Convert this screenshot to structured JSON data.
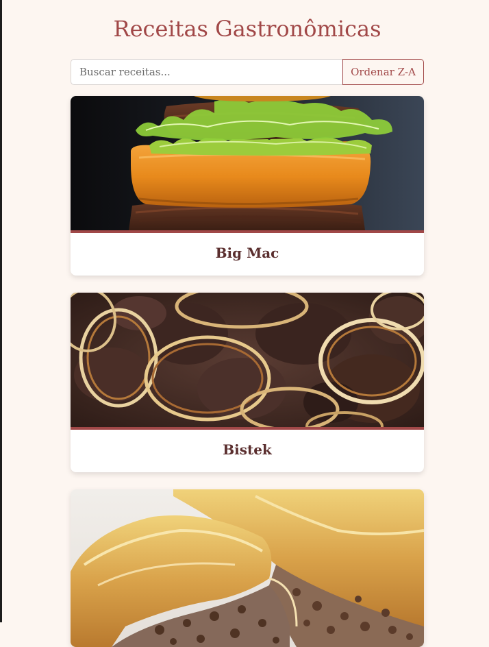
{
  "header": {
    "title": "Receitas Gastronômicas"
  },
  "search": {
    "placeholder": "Buscar receitas...",
    "value": ""
  },
  "toolbar": {
    "sort_label": "Ordenar Z-A"
  },
  "recipes": [
    {
      "name": "Big Mac"
    },
    {
      "name": "Bistek"
    },
    {
      "name": ""
    }
  ],
  "colors": {
    "accent": "#a14848",
    "background": "#fdf6f1",
    "card_title": "#5a2e2e"
  }
}
